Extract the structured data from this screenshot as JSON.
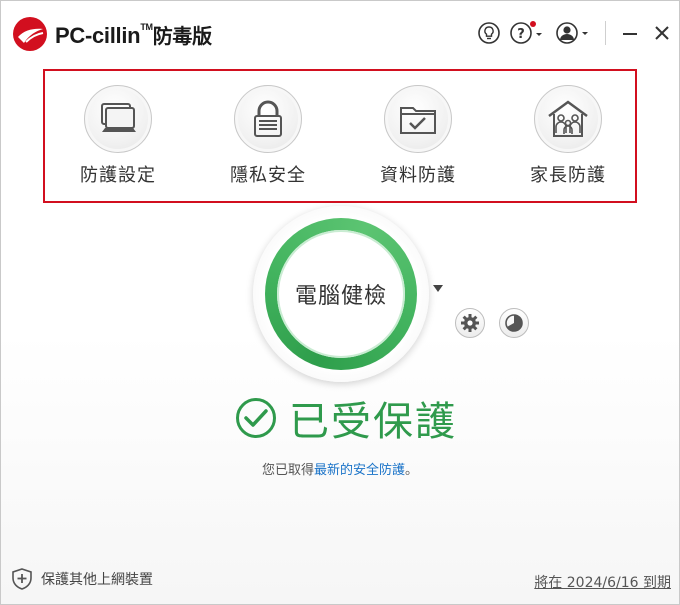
{
  "app": {
    "name": "PC-cillin",
    "trademark": "TM",
    "edition": "防毒版"
  },
  "titlebar": {
    "tips_icon": "lightbulb-icon",
    "help_icon": "help-icon",
    "account_icon": "account-icon",
    "minimize_icon": "minimize-icon",
    "close_icon": "close-icon"
  },
  "features": [
    {
      "label": "防護設定",
      "icon": "laptop-icon"
    },
    {
      "label": "隱私安全",
      "icon": "lock-icon"
    },
    {
      "label": "資料防護",
      "icon": "folder-check-icon"
    },
    {
      "label": "家長防護",
      "icon": "family-house-icon"
    }
  ],
  "scan": {
    "label": "電腦健檢"
  },
  "status": {
    "title": "已受保護",
    "sub_prefix": "您已取得",
    "sub_link": "最新的安全防護",
    "sub_suffix": "。"
  },
  "footer": {
    "protect_devices": "保護其他上網裝置",
    "expiry": "將在 2024/6/16 到期"
  },
  "colors": {
    "brand_red": "#d20f1f",
    "protected_green": "#2f9a4c",
    "link_blue": "#1a73c8"
  }
}
